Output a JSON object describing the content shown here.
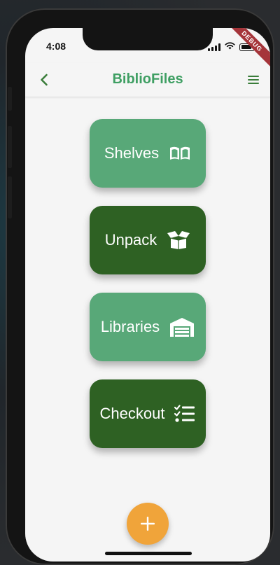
{
  "status_bar": {
    "time": "4:08",
    "battery_level": 0.9,
    "icons": [
      "signal-icon",
      "wifi-icon",
      "battery-icon"
    ]
  },
  "debug_banner": "DEBUG",
  "app_bar": {
    "title": "BiblioFiles",
    "back_icon": "chevron-left-icon",
    "menu_icon": "hamburger-menu-icon"
  },
  "menu": {
    "items": [
      {
        "label": "Shelves",
        "icon": "open-book-icon",
        "style": "light"
      },
      {
        "label": "Unpack",
        "icon": "open-box-icon",
        "style": "dark"
      },
      {
        "label": "Libraries",
        "icon": "warehouse-icon",
        "style": "light"
      },
      {
        "label": "Checkout",
        "icon": "checklist-icon",
        "style": "dark"
      }
    ]
  },
  "fab": {
    "icon": "plus-icon",
    "label": "+"
  },
  "colors": {
    "primary": "#3f9f63",
    "tile_light": "#58a878",
    "tile_dark": "#2e6123",
    "fab": "#f0a43a",
    "debug_ribbon": "#a5353a",
    "background": "#f5f5f5"
  }
}
